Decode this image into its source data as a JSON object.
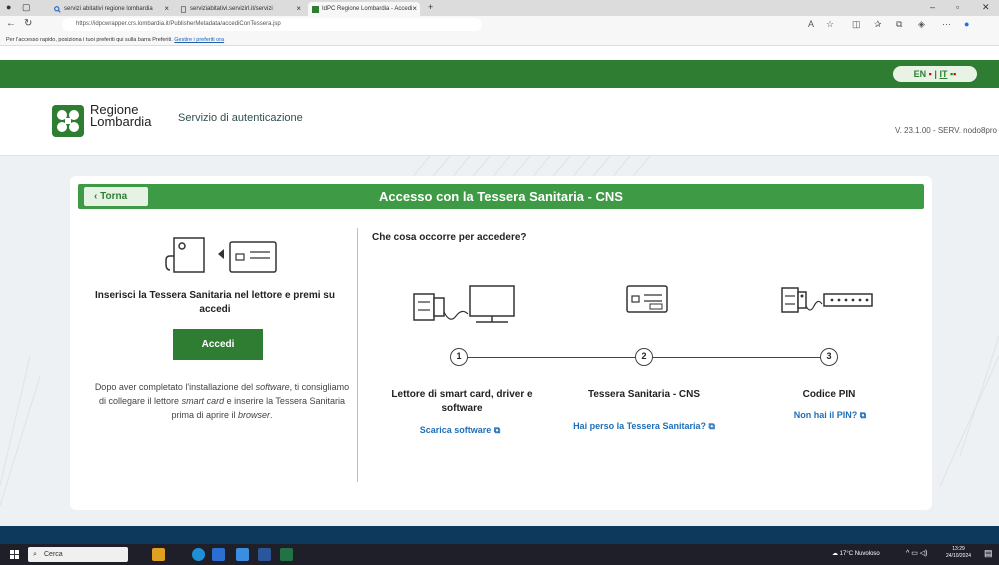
{
  "browser": {
    "tabs": [
      {
        "label": "servizi abitativi regione lombardia"
      },
      {
        "label": "serviziabitativi.servizirl.it/servizi"
      },
      {
        "label": "IdPC Regione Lombardia - Accedi"
      }
    ],
    "new_tab": "+",
    "url": "https://idpcwrapper.crs.lombardia.it/PublisherMetadata/accediConTessera.jsp",
    "favorites_bar_text": "Per l'accesso rapido, posiziona i tuoi preferiti qui sulla barra Preferiti.",
    "favorites_bar_link": "Gestire i preferiti ora"
  },
  "lang": {
    "en": "EN",
    "sep": "|",
    "it": "IT"
  },
  "header": {
    "logo_line1": "Regione",
    "logo_line2": "Lombardia",
    "service_name": "Servizio di autenticazione",
    "version": "V. 23.1.00 - SERV. nodo8pro"
  },
  "card": {
    "back_label": "‹ Torna",
    "title": "Accesso con la Tessera Sanitaria - CNS",
    "insert_text": "Inserisci la Tessera Sanitaria nel lettore e premi su accedi",
    "accedi_label": "Accedi",
    "after_install_1": "Dopo aver completato l'installazione del ",
    "after_install_software": "software",
    "after_install_2": ", ti consigliamo di collegare il lettore ",
    "after_install_card": "smart card",
    "after_install_3": " e inserire la Tessera Sanitaria prima di aprire il ",
    "after_install_browser": "browser",
    "after_install_4": ".",
    "what_need": "Che cosa occorre per accedere?",
    "steps": [
      {
        "num": "1",
        "label": "Lettore di smart card, driver e software",
        "link": "Scarica software"
      },
      {
        "num": "2",
        "label": "Tessera Sanitaria - CNS",
        "link": "Hai perso la Tessera Sanitaria?"
      },
      {
        "num": "3",
        "label": "Codice PIN",
        "link": "Non hai il PIN?"
      }
    ]
  },
  "taskbar": {
    "search_placeholder": "Cerca",
    "weather": "17°C Nuvoloso",
    "time": "13:29",
    "date": "24/10/2024"
  },
  "colors": {
    "green_dark": "#2f7d32",
    "green_head": "#3f9a45",
    "link_blue": "#1e6fb8",
    "band_blue": "#0d3a5c"
  }
}
